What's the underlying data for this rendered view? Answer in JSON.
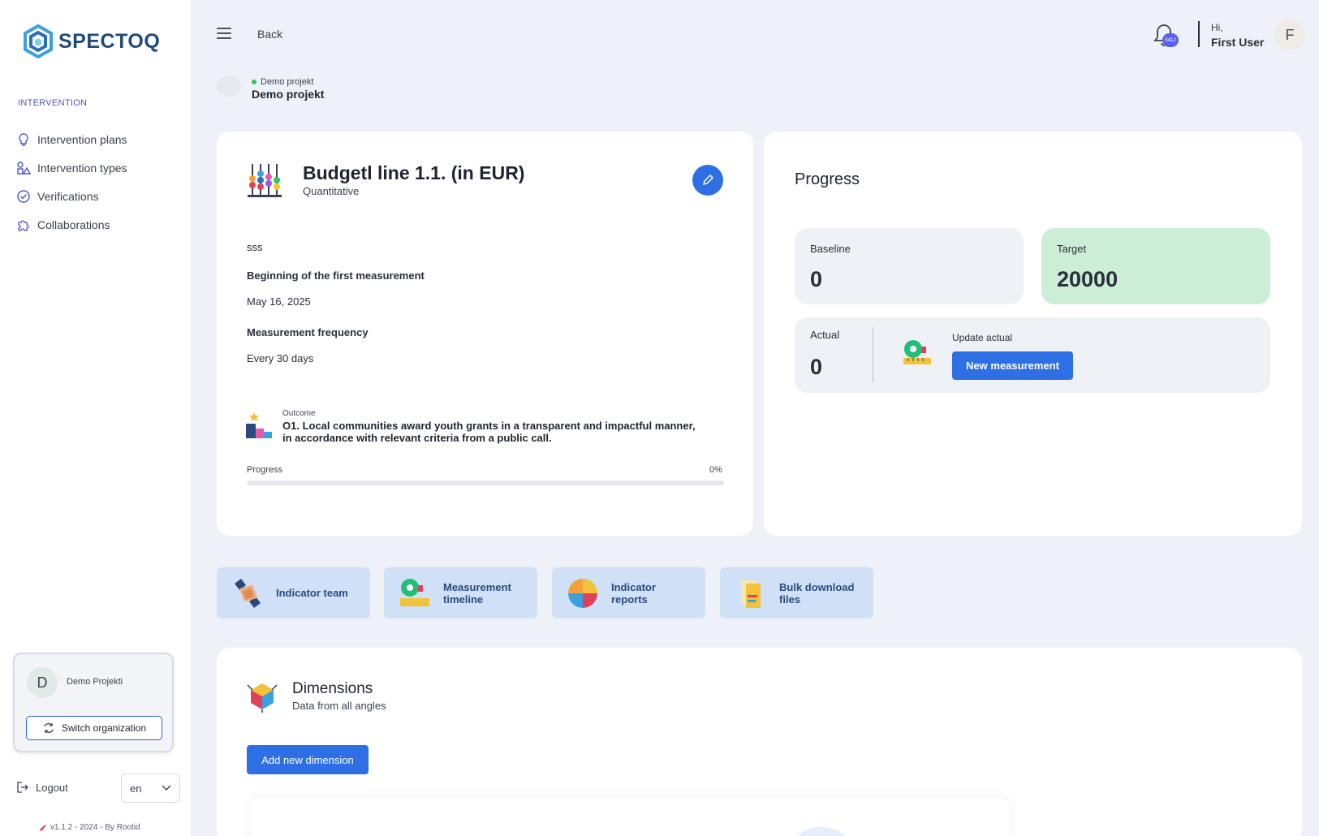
{
  "sidebar": {
    "logo_text": "SPECTOQ",
    "section_label": "INTERVENTION",
    "items": [
      {
        "label": "Intervention plans",
        "icon": "lightbulb-icon"
      },
      {
        "label": "Intervention types",
        "icon": "shapes-icon"
      },
      {
        "label": "Verifications",
        "icon": "check-circle-icon"
      },
      {
        "label": "Collaborations",
        "icon": "puzzle-icon"
      }
    ],
    "organization": {
      "initial": "D",
      "name": "Demo Projekti",
      "switch_label": "Switch organization"
    },
    "logout_label": "Logout",
    "language": "en",
    "version": "v1.1.2 - 2024 - By Rootid"
  },
  "header": {
    "back_label": "Back",
    "notification_badge": "5412",
    "greeting_hi": "Hi,",
    "user_name": "First User",
    "user_initial": "F"
  },
  "project": {
    "status_label": "Demo projekt",
    "name": "Demo projekt"
  },
  "indicator": {
    "title": "Budgetl line 1.1. (in EUR)",
    "type": "Quantitative",
    "description": "sss",
    "first_measurement_label": "Beginning of the first measurement",
    "first_measurement_value": "May 16, 2025",
    "frequency_label": "Measurement frequency",
    "frequency_value": "Every 30 days",
    "outcome_label": "Outcome",
    "outcome_text": "O1. Local communities award youth grants in a transparent and impactful manner, in accordance with relevant criteria from a public call.",
    "progress_label": "Progress",
    "progress_percent_text": "0%",
    "progress_fraction": 0
  },
  "progress_panel": {
    "title": "Progress",
    "baseline_label": "Baseline",
    "baseline_value": "0",
    "target_label": "Target",
    "target_value": "20000",
    "actual_label": "Actual",
    "actual_value": "0",
    "update_label": "Update actual",
    "new_measurement_label": "New measurement"
  },
  "tiles": [
    {
      "label": "Indicator team",
      "icon": "handshake-icon"
    },
    {
      "label": "Measurement timeline",
      "icon": "tape-measure-icon"
    },
    {
      "label": "Indicator reports",
      "icon": "pie-chart-icon"
    },
    {
      "label": "Bulk download files",
      "icon": "files-icon"
    }
  ],
  "dimensions": {
    "title": "Dimensions",
    "subtitle": "Data from all angles",
    "add_label": "Add new dimension"
  },
  "colors": {
    "accent": "#2e6fe6",
    "target_bg": "#cdeed6",
    "tile_bg": "#cfe0f7",
    "status_green": "#31c46b"
  }
}
